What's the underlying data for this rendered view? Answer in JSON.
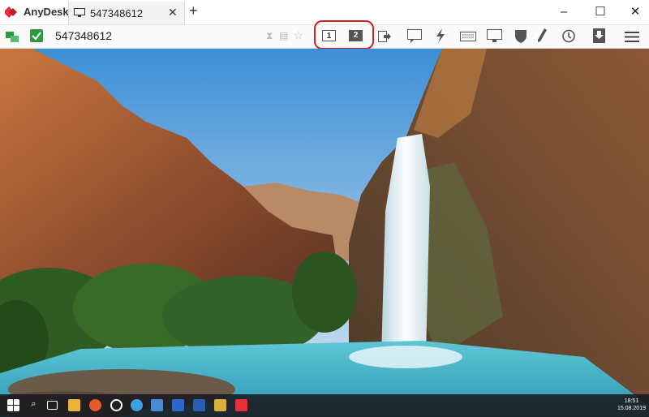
{
  "app": {
    "name": "AnyDesk"
  },
  "tab": {
    "label": "547348612"
  },
  "address": {
    "value": "547348612"
  },
  "monitors": [
    {
      "label": "1",
      "active": false
    },
    {
      "label": "2",
      "active": true
    }
  ],
  "window_controls": {
    "minimize": "–",
    "maximize": "☐",
    "close": "✕"
  },
  "toolbar_icons": [
    "switch-sides-icon",
    "chat-icon",
    "actions-icon",
    "keyboard-icon",
    "display-icon",
    "permissions-icon",
    "whiteboard-icon",
    "session-recording-icon",
    "file-transfer-icon",
    "menu-icon"
  ],
  "remote_desktop": {
    "wallpaper": "waterfall canyon landscape",
    "taskbar": {
      "clock_time": "18:51",
      "clock_date": "15.08.2019"
    }
  },
  "colors": {
    "brand": "#e3303a",
    "highlight": "#d01e2a",
    "status_green": "#2e9a3e"
  }
}
